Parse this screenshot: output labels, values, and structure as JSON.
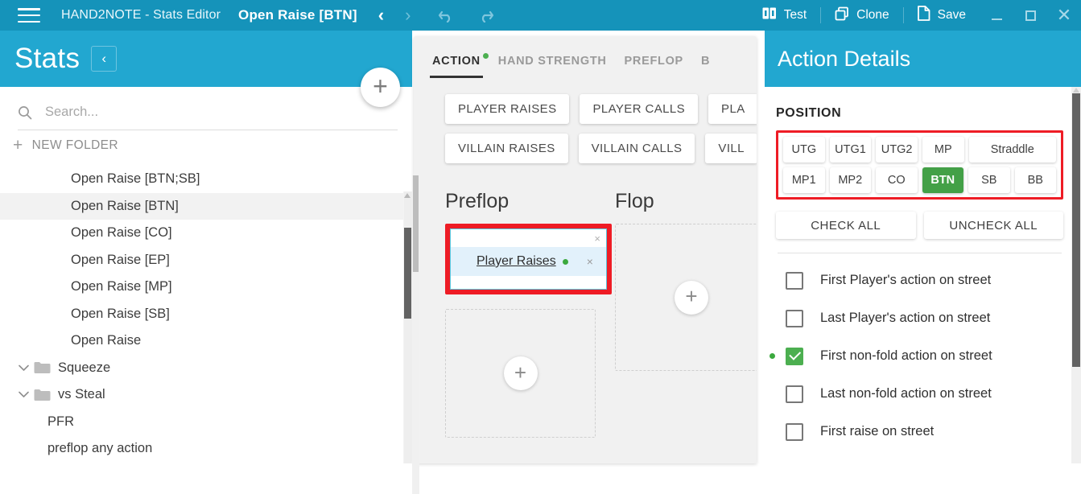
{
  "titlebar": {
    "app_title": "HAND2NOTE - Stats Editor",
    "document_title": "Open Raise [BTN]",
    "back_arrow": "‹",
    "forward_arrow": "›",
    "actions": [
      {
        "label": "Test",
        "icon": "test-icon"
      },
      {
        "label": "Clone",
        "icon": "clone-icon"
      },
      {
        "label": "Save",
        "icon": "save-document-icon"
      }
    ],
    "window_controls": {
      "minimize": "–",
      "maximize": "□",
      "close": "✕"
    }
  },
  "sidebar": {
    "title": "Stats",
    "collapse_label": "‹",
    "add_button_label": "+",
    "search": {
      "value": "",
      "placeholder": "Search..."
    },
    "new_folder_label": "NEW FOLDER",
    "new_folder_plus": "+",
    "tree": [
      {
        "label": "Open Raise [BTN;SB]",
        "type": "stat",
        "selected": false,
        "indent": 3
      },
      {
        "label": "Open Raise [BTN]",
        "type": "stat",
        "selected": true,
        "indent": 3
      },
      {
        "label": "Open Raise [CO]",
        "type": "stat",
        "selected": false,
        "indent": 3
      },
      {
        "label": "Open Raise [EP]",
        "type": "stat",
        "selected": false,
        "indent": 3
      },
      {
        "label": "Open Raise [MP]",
        "type": "stat",
        "selected": false,
        "indent": 3
      },
      {
        "label": "Open Raise [SB]",
        "type": "stat",
        "selected": false,
        "indent": 3
      },
      {
        "label": "Open Raise",
        "type": "stat",
        "selected": false,
        "indent": 3
      },
      {
        "label": "Squeeze",
        "type": "folder",
        "expanded": true,
        "selected": false,
        "indent": 0
      },
      {
        "label": "vs Steal",
        "type": "folder",
        "expanded": true,
        "selected": false,
        "indent": 0
      },
      {
        "label": "PFR",
        "type": "stat",
        "selected": false,
        "indent": 1
      },
      {
        "label": "preflop any action",
        "type": "stat",
        "selected": false,
        "indent": 1
      }
    ]
  },
  "center": {
    "tabs": [
      {
        "label": "ACTION",
        "active": true,
        "dot": true
      },
      {
        "label": "HAND STRENGTH",
        "active": false,
        "dot": false
      },
      {
        "label": "PREFLOP",
        "active": false,
        "dot": false
      },
      {
        "label": "B",
        "active": false,
        "dot": false
      }
    ],
    "action_buttons_row1": [
      "PLAYER RAISES",
      "PLAYER CALLS",
      "PLA"
    ],
    "action_buttons_row2": [
      "VILLAIN RAISES",
      "VILLAIN CALLS",
      "VILL"
    ],
    "streets": [
      {
        "title": "Preflop",
        "action": {
          "label": "Player Raises",
          "has_dot": true,
          "close": "×",
          "corner_close": "×"
        },
        "dropzone_plus": "+"
      },
      {
        "title": "Flop",
        "action": null,
        "dropzone_plus": "+"
      }
    ]
  },
  "right": {
    "title": "Action Details",
    "section_label": "POSITION",
    "positions_row1": [
      {
        "label": "UTG",
        "selected": false,
        "wide": false
      },
      {
        "label": "UTG1",
        "selected": false,
        "wide": false
      },
      {
        "label": "UTG2",
        "selected": false,
        "wide": false
      },
      {
        "label": "MP",
        "selected": false,
        "wide": false
      },
      {
        "label": "Straddle",
        "selected": false,
        "wide": true
      }
    ],
    "positions_row2": [
      {
        "label": "MP1",
        "selected": false,
        "wide": false
      },
      {
        "label": "MP2",
        "selected": false,
        "wide": false
      },
      {
        "label": "CO",
        "selected": false,
        "wide": false
      },
      {
        "label": "BTN",
        "selected": true,
        "wide": false
      },
      {
        "label": "SB",
        "selected": false,
        "wide": false
      },
      {
        "label": "BB",
        "selected": false,
        "wide": false
      }
    ],
    "check_all_label": "CHECK ALL",
    "uncheck_all_label": "UNCHECK ALL",
    "options": [
      {
        "label": "First Player's action on street",
        "checked": false,
        "bullet": false
      },
      {
        "label": "Last Player's action on street",
        "checked": false,
        "bullet": false
      },
      {
        "label": "First non-fold action on street",
        "checked": true,
        "bullet": true
      },
      {
        "label": "Last non-fold action on street",
        "checked": false,
        "bullet": false
      },
      {
        "label": "First raise on street",
        "checked": false,
        "bullet": false
      }
    ]
  },
  "colors": {
    "titlebar": "#1593ba",
    "panel_header": "#22a7d0",
    "accent_green": "#43a047",
    "highlight_red": "#ee1c25",
    "chip_blue": "#e2f1fb"
  }
}
